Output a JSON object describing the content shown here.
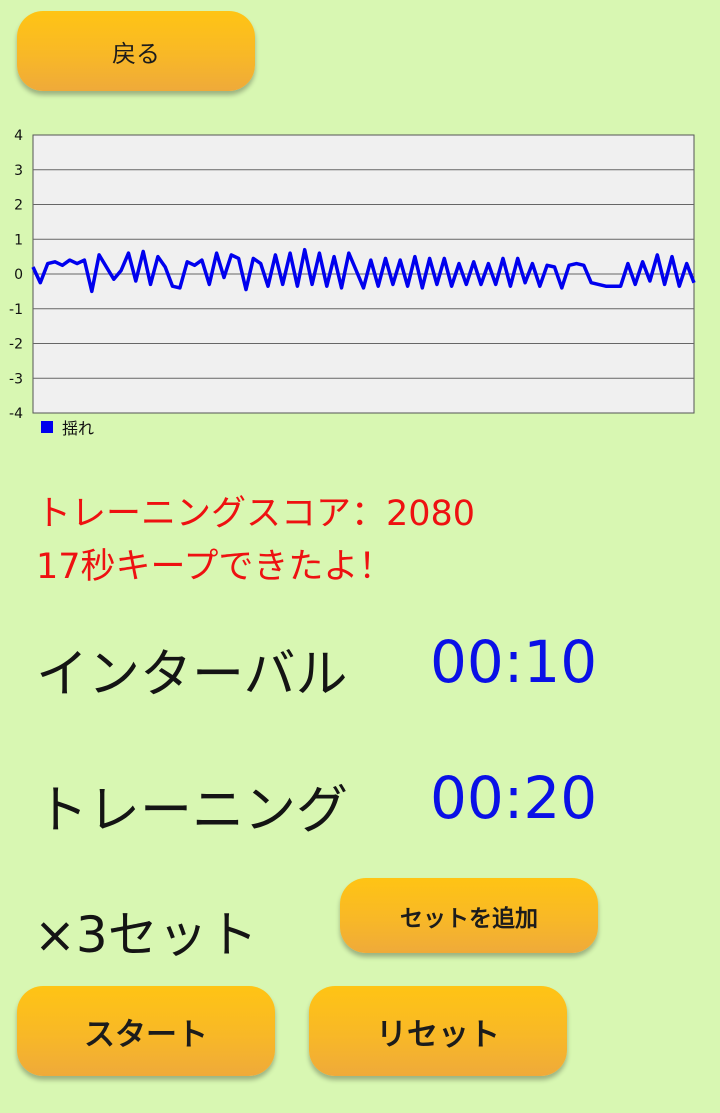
{
  "buttons": {
    "back": "戻る",
    "add_set": "セットを追加",
    "start": "スタート",
    "reset": "リセット"
  },
  "chart_data": {
    "type": "line",
    "ylim": [
      -4,
      4
    ],
    "y_ticks": [
      "4",
      "3",
      "2",
      "1",
      "0",
      "-1",
      "-2",
      "-3",
      "-4"
    ],
    "grid": true,
    "legend_position": "bottom-left",
    "series": [
      {
        "name": "揺れ",
        "color": "#0000ee",
        "values": [
          0.2,
          -0.25,
          0.3,
          0.35,
          0.25,
          0.4,
          0.3,
          0.4,
          -0.5,
          0.55,
          0.2,
          -0.15,
          0.1,
          0.6,
          -0.2,
          0.65,
          -0.3,
          0.5,
          0.2,
          -0.35,
          -0.4,
          0.35,
          0.25,
          0.4,
          -0.3,
          0.6,
          -0.1,
          0.55,
          0.45,
          -0.45,
          0.45,
          0.3,
          -0.35,
          0.55,
          -0.3,
          0.6,
          -0.35,
          0.7,
          -0.3,
          0.6,
          -0.35,
          0.5,
          -0.4,
          0.6,
          0.1,
          -0.4,
          0.4,
          -0.35,
          0.45,
          -0.3,
          0.4,
          -0.35,
          0.5,
          -0.4,
          0.45,
          -0.3,
          0.45,
          -0.35,
          0.3,
          -0.3,
          0.35,
          -0.3,
          0.3,
          -0.3,
          0.45,
          -0.35,
          0.45,
          -0.25,
          0.3,
          -0.35,
          0.25,
          0.2,
          -0.4,
          0.25,
          0.3,
          0.25,
          -0.25,
          -0.3,
          -0.35,
          -0.35,
          -0.35,
          0.3,
          -0.3,
          0.35,
          -0.2,
          0.55,
          -0.3,
          0.5,
          -0.35,
          0.3,
          -0.25
        ]
      }
    ]
  },
  "score": {
    "line1": "トレーニングスコア：2080",
    "line2": "17秒キープできたよ！"
  },
  "timers": {
    "interval_label": "インターバル",
    "interval_value": "00:10",
    "training_label": "トレーニング",
    "training_value": "00:20"
  },
  "sets": {
    "label": "×3セット"
  }
}
